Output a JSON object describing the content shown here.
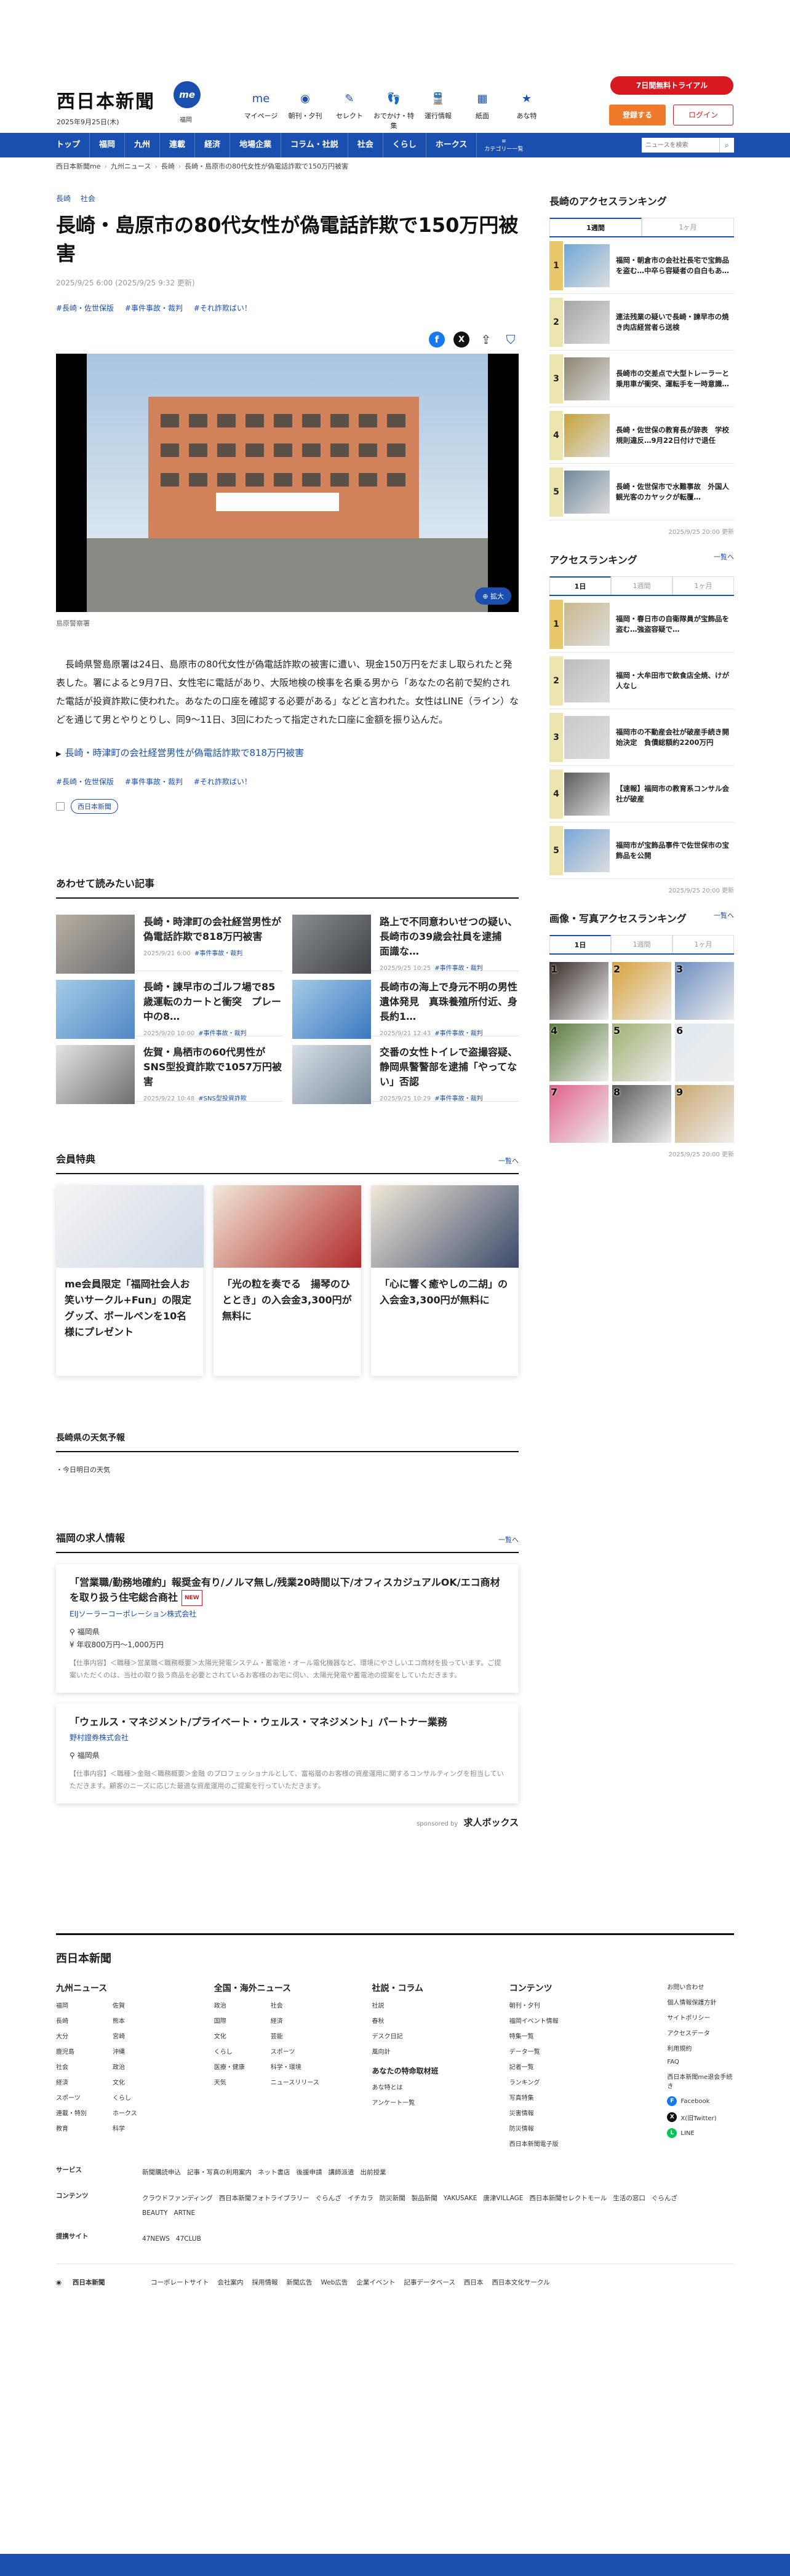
{
  "header": {
    "logo": "西日本新聞",
    "date": "2025年9月25日(木)",
    "me_badge": "me",
    "me_sub": "福岡",
    "nav": [
      {
        "icon": "me-icon",
        "glyph": "me",
        "label": "マイページ"
      },
      {
        "icon": "newspaper-icon",
        "glyph": "◉",
        "label": "朝刊・夕刊"
      },
      {
        "icon": "select-icon",
        "glyph": "✎",
        "label": "セレクト"
      },
      {
        "icon": "outing-icon",
        "glyph": "👣",
        "label": "おでかけ・特集"
      },
      {
        "icon": "train-icon",
        "glyph": "🚆",
        "label": "運行情報"
      },
      {
        "icon": "paper-icon",
        "glyph": "▦",
        "label": "紙面"
      },
      {
        "icon": "anatoku-icon",
        "glyph": "★",
        "label": "あな特"
      }
    ],
    "trial": "7日間無料トライアル",
    "register": "登録する",
    "login": "ログイン"
  },
  "gnav": {
    "items": [
      "トップ",
      "福岡",
      "九州",
      "連載",
      "経済",
      "地場企業",
      "コラム・社説",
      "社会",
      "くらし",
      "ホークス"
    ],
    "category": "カテゴリー一覧",
    "search_placeholder": "ニュースを検索"
  },
  "breadcrumb": [
    "西日本新聞me",
    "九州ニュース",
    "長崎",
    "長崎・島原市の80代女性が偽電話詐欺で150万円被害"
  ],
  "article": {
    "tags": [
      "長崎",
      "社会"
    ],
    "title": "長崎・島原市の80代女性が偽電話詐欺で150万円被害",
    "date": "2025/9/25 6:00 (2025/9/25 9:32 更新)",
    "hashtags": [
      "#長崎・佐世保版",
      "#事件事故・裁判",
      "#それ詐欺ばい！"
    ],
    "zoom": "拡大",
    "caption": "島原警察署",
    "body": "長崎県警島原署は24日、島原市の80代女性が偽電話詐欺の被害に遭い、現金150万円をだまし取られたと発表した。署によると9月7日、女性宅に電話があり、大阪地検の検事を名乗る男から「あなたの名前で契約された電話が投資詐欺に使われた。あなたの口座を確認する必要がある」などと言われた。女性はLINE（ライン）などを通じて男とやりとりし、同9～11日、3回にわたって指定された口座に金額を振り込んだ。",
    "related_link": "長崎・時津町の会社経営男性が偽電話詐欺で818万円被害",
    "hashtags2": [
      "#長崎・佐世保版",
      "#事件事故・裁判",
      "#それ詐欺ばい！"
    ],
    "publisher": "西日本新聞"
  },
  "also": {
    "heading": "あわせて読みたい記事",
    "items": [
      {
        "title": "長崎・時津町の会社経営男性が偽電話詐欺で818万円被害",
        "date": "2025/9/21 6:00",
        "tag": "#事件事故・裁判"
      },
      {
        "title": "路上で不同意わいせつの疑い、長崎市の39歳会社員を逮捕　面識な…",
        "date": "2025/9/25 10:25",
        "tag": "#事件事故・裁判"
      },
      {
        "title": "長崎・諫早市のゴルフ場で85歳運転のカートと衝突　プレー中の8…",
        "date": "2025/9/20 10:00",
        "tag": "#事件事故・裁判"
      },
      {
        "title": "長崎市の海上で身元不明の男性遺体発見　真珠養殖所付近、身長約1…",
        "date": "2025/9/21 12:43",
        "tag": "#事件事故・裁判"
      },
      {
        "title": "佐賀・鳥栖市の60代男性がSNS型投資詐欺で1057万円被害",
        "date": "2025/9/22 10:48",
        "tag": "#SNS型投資詐欺"
      },
      {
        "title": "交番の女性トイレで盗撮容疑、静岡県警警部を逮捕「やってない」否認",
        "date": "2025/9/25 10:29",
        "tag": "#事件事故・裁判"
      }
    ]
  },
  "benefits": {
    "heading": "会員特典",
    "more": "一覧へ",
    "items": [
      "me会員限定「福岡社会人お笑いサークル+Fun」の限定グッズ、ボールペンを10名様にプレゼント",
      "「光の粒を奏でる　揚琴のひととき」の入会金3,300円が無料に",
      "「心に響く癒やしの二胡」の入会金3,300円が無料に"
    ]
  },
  "weather": {
    "heading": "長崎県の天気予報",
    "label": "今日明日の天気"
  },
  "jobs": {
    "heading": "福岡の求人情報",
    "more": "一覧へ",
    "items": [
      {
        "title": "「営業職/勤務地確約」報奨金有り/ノルマ無し/残業20時間以下/オフィスカジュアルOK/エコ商材を取り扱う住宅総合商社",
        "new": "NEW",
        "company": "EIJソーラーコーポレーション株式会社",
        "location": "福岡県",
        "salary": "年収800万円～1,000万円",
        "desc": "【仕事内容】＜職種＞営業職＜職務概要＞太陽光発電システム・蓄電池・オール電化機器など、環境にやさしいエコ商材を扱っています。ご提案いただくのは、当社の取り扱う商品を必要とされているお客様のお宅に伺い、太陽光発電や蓄電池の提案をしていただきます。"
      },
      {
        "title": "「ウェルス・マネジメント/プライベート・ウェルス・マネジメント」パートナー業務",
        "new": "",
        "company": "野村證券株式会社",
        "location": "福岡県",
        "salary": "",
        "desc": "【仕事内容】＜職種＞金融＜職務概要＞金融 のプロフェッショナルとして、富裕層のお客様の資産運用に関するコンサルティングを担当していただきます。顧客のニーズに応じた最適な資産運用のご提案を行っていただきます。"
      }
    ],
    "sponsor": "sponsored by",
    "sponsor_brand": "求人ボックス"
  },
  "sidebar": {
    "access_heading": "長崎のアクセスランキング",
    "access_tabs": [
      "1週間",
      "1ヶ月"
    ],
    "access": [
      "福岡・朝倉市の会社社長宅で宝飾品を盗む…中卒ら容疑者の自白もあ…",
      "連法残業の疑いで長崎・諫早市の焼き肉店経営者ら送検",
      "長崎市の交差点で大型トレーラーと乗用車が衝突、運転手を一時意識…",
      "長崎・佐世保の教育長が辞表　学校規則違反…9月22日付けで退任",
      "長崎・佐世保市で水難事故　外国人観光客のカヤックが転覆…"
    ],
    "access_upd": "2025/9/25 20:00 更新",
    "ar_heading": "アクセスランキング",
    "ar_more": "一覧へ",
    "ar_tabs": [
      "1日",
      "1週間",
      "1ヶ月"
    ],
    "ar": [
      "福岡・春日市の自衛隊員が宝飾品を盗む…強盗容疑で…",
      "福岡・大牟田市で飲食店全焼、けが人なし",
      "福岡市の不動産会社が破産手続き開始決定　負債総額約2200万円",
      "【速報】福岡市の教育系コンサル会社が破産",
      "福岡市が宝飾品事件で佐世保市の宝飾品を公開"
    ],
    "ar_upd": "2025/9/25 20:00 更新",
    "gal_heading": "画像・写真アクセスランキング",
    "gal_more": "一覧へ",
    "gal_tabs": [
      "1日",
      "1週間",
      "1ヶ月"
    ],
    "gal_upd": "2025/9/25 20:00 更新"
  },
  "footer": {
    "logo": "西日本新聞",
    "cols": [
      {
        "h": "九州ニュース",
        "items": [
          "福岡",
          "佐賀",
          "長崎",
          "熊本",
          "大分",
          "宮崎",
          "鹿児島",
          "沖縄",
          "社会",
          "政治",
          "経済",
          "文化",
          "スポーツ",
          "くらし",
          "連載・特別",
          "ホークス",
          "教育",
          "科学"
        ]
      },
      {
        "h": "全国・海外ニュース",
        "items": [
          "政治",
          "社会",
          "国際",
          "経済",
          "文化",
          "芸能",
          "くらし",
          "スポーツ",
          "医療・健康",
          "科学・環境",
          "天気",
          "ニュースリリース"
        ]
      },
      {
        "h": "社説・コラム",
        "items": [
          "社説",
          "春秋",
          "デスク日記",
          "風向計"
        ],
        "h2": "あなたの特命取材班",
        "items2": [
          "あな特とは",
          "アンケート一覧"
        ]
      },
      {
        "h": "コンテンツ",
        "items": [
          "朝刊・夕刊",
          "福岡イベント情報",
          "特集一覧",
          "データ一覧",
          "記者一覧",
          "ランキング",
          "写真特集",
          "災害情報",
          "防災情報",
          "西日本新聞電子版"
        ]
      }
    ],
    "misc": [
      "お問い合わせ",
      "個人情報保護方針",
      "サイトポリシー",
      "アクセスデータ",
      "利用規約",
      "FAQ",
      "西日本新聞me退会手続き"
    ],
    "social": [
      {
        "icon": "facebook-icon",
        "label": "Facebook",
        "color": "#1877f2"
      },
      {
        "icon": "x-icon",
        "label": "X(旧Twitter)",
        "color": "#111111"
      },
      {
        "icon": "line-icon",
        "label": "LINE",
        "color": "#06c755"
      }
    ],
    "rows": [
      {
        "h": "サービス",
        "v": [
          "新聞購読申込",
          "記事・写真の利用案内",
          "ネット書店",
          "後援申請",
          "講師派遣",
          "出前授業"
        ]
      },
      {
        "h": "コンテンツ",
        "v": [
          "クラウドファンディング",
          "西日本新聞フォトライブラリー",
          "ぐらんざ",
          "イチカラ",
          "防災新聞",
          "製品新聞",
          "YAKUSAKE",
          "唐津VILLAGE",
          "西日本新聞セレクトモール",
          "生活の窓口",
          "ぐらんざBEAUTY",
          "ARTNE"
        ]
      },
      {
        "h": "提携サイト",
        "v": [
          "47NEWS",
          "47CLUB"
        ]
      }
    ],
    "bottom_logo": "西日本新聞",
    "bottom": [
      "コーポレートサイト",
      "会社案内",
      "採用情報",
      "新聞広告",
      "Web広告",
      "企業イベント",
      "記事データベース",
      "西日本",
      "西日本文化サークル"
    ]
  }
}
